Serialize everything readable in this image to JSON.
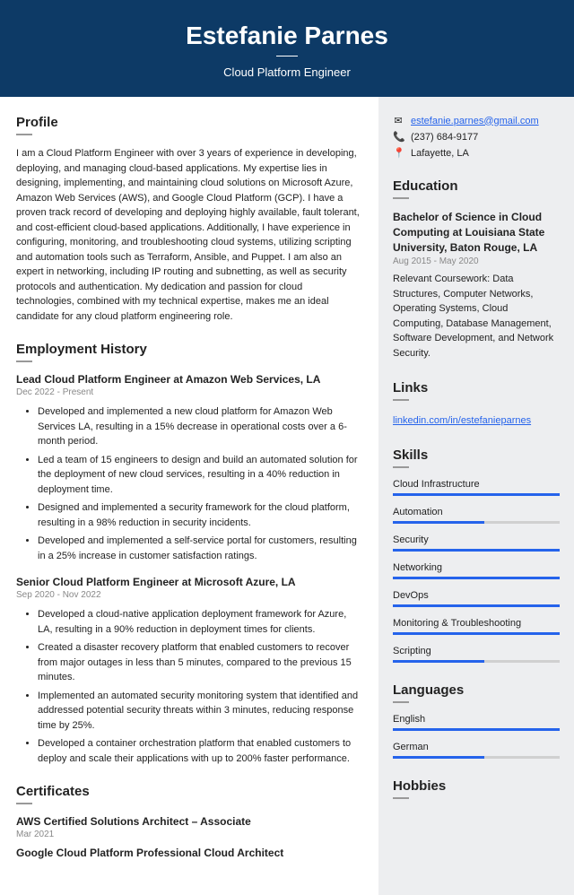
{
  "header": {
    "name": "Estefanie Parnes",
    "title": "Cloud Platform Engineer"
  },
  "profile": {
    "heading": "Profile",
    "text": "I am a Cloud Platform Engineer with over 3 years of experience in developing, deploying, and managing cloud-based applications. My expertise lies in designing, implementing, and maintaining cloud solutions on Microsoft Azure, Amazon Web Services (AWS), and Google Cloud Platform (GCP). I have a proven track record of developing and deploying highly available, fault tolerant, and cost-efficient cloud-based applications. Additionally, I have experience in configuring, monitoring, and troubleshooting cloud systems, utilizing scripting and automation tools such as Terraform, Ansible, and Puppet. I am also an expert in networking, including IP routing and subnetting, as well as security protocols and authentication. My dedication and passion for cloud technologies, combined with my technical expertise, makes me an ideal candidate for any cloud platform engineering role."
  },
  "employment": {
    "heading": "Employment History",
    "jobs": [
      {
        "title": "Lead Cloud Platform Engineer at Amazon Web Services, LA",
        "date": "Dec 2022 - Present",
        "bullets": [
          "Developed and implemented a new cloud platform for Amazon Web Services LA, resulting in a 15% decrease in operational costs over a 6-month period.",
          "Led a team of 15 engineers to design and build an automated solution for the deployment of new cloud services, resulting in a 40% reduction in deployment time.",
          "Designed and implemented a security framework for the cloud platform, resulting in a 98% reduction in security incidents.",
          "Developed and implemented a self-service portal for customers, resulting in a 25% increase in customer satisfaction ratings."
        ]
      },
      {
        "title": "Senior Cloud Platform Engineer at Microsoft Azure, LA",
        "date": "Sep 2020 - Nov 2022",
        "bullets": [
          "Developed a cloud-native application deployment framework for Azure, LA, resulting in a 90% reduction in deployment times for clients.",
          "Created a disaster recovery platform that enabled customers to recover from major outages in less than 5 minutes, compared to the previous 15 minutes.",
          "Implemented an automated security monitoring system that identified and addressed potential security threats within 3 minutes, reducing response time by 25%.",
          "Developed a container orchestration platform that enabled customers to deploy and scale their applications with up to 200% faster performance."
        ]
      }
    ]
  },
  "certificates": {
    "heading": "Certificates",
    "items": [
      {
        "title": "AWS Certified Solutions Architect – Associate",
        "date": "Mar 2021"
      },
      {
        "title": "Google Cloud Platform Professional Cloud Architect",
        "date": ""
      }
    ]
  },
  "contact": {
    "email": "estefanie.parnes@gmail.com",
    "phone": "(237) 684-9177",
    "location": "Lafayette, LA"
  },
  "education": {
    "heading": "Education",
    "degree": "Bachelor of Science in Cloud Computing at Louisiana State University, Baton Rouge, LA",
    "date": "Aug 2015 - May 2020",
    "desc": "Relevant Coursework: Data Structures, Computer Networks, Operating Systems, Cloud Computing, Database Management, Software Development, and Network Security."
  },
  "links": {
    "heading": "Links",
    "url": "linkedin.com/in/estefanieparnes"
  },
  "skills": {
    "heading": "Skills",
    "items": [
      {
        "name": "Cloud Infrastructure",
        "level": 100
      },
      {
        "name": "Automation",
        "level": 55
      },
      {
        "name": "Security",
        "level": 100
      },
      {
        "name": "Networking",
        "level": 100
      },
      {
        "name": "DevOps",
        "level": 100
      },
      {
        "name": "Monitoring & Troubleshooting",
        "level": 100
      },
      {
        "name": "Scripting",
        "level": 55
      }
    ]
  },
  "languages": {
    "heading": "Languages",
    "items": [
      {
        "name": "English",
        "level": 100
      },
      {
        "name": "German",
        "level": 55
      }
    ]
  },
  "hobbies": {
    "heading": "Hobbies"
  }
}
